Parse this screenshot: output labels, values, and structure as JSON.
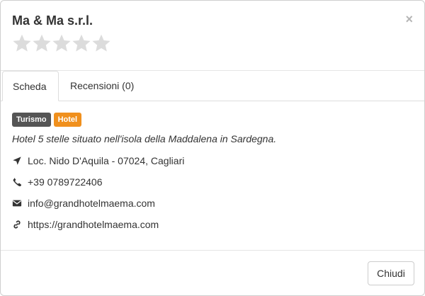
{
  "header": {
    "title": "Ma & Ma s.r.l.",
    "close_label": "×",
    "rating": {
      "value": 0,
      "max": 5
    }
  },
  "tabs": [
    {
      "label": "Scheda",
      "active": true
    },
    {
      "label": "Recensioni (0)",
      "active": false
    }
  ],
  "details": {
    "labels": [
      {
        "text": "Turismo",
        "color": "#555555"
      },
      {
        "text": "Hotel",
        "color": "#f0901d"
      }
    ],
    "description": "Hotel 5 stelle situato nell'isola della Maddalena in Sardegna.",
    "address": "Loc. Nido D'Aquila - 07024, Cagliari",
    "phone": "+39 0789722406",
    "email": "info@grandhotelmaema.com",
    "website": "https://grandhotelmaema.com",
    "icons": {
      "address": "location-arrow-icon",
      "phone": "phone-icon",
      "email": "envelope-icon",
      "website": "link-icon"
    }
  },
  "footer": {
    "close_button": "Chiudi"
  }
}
